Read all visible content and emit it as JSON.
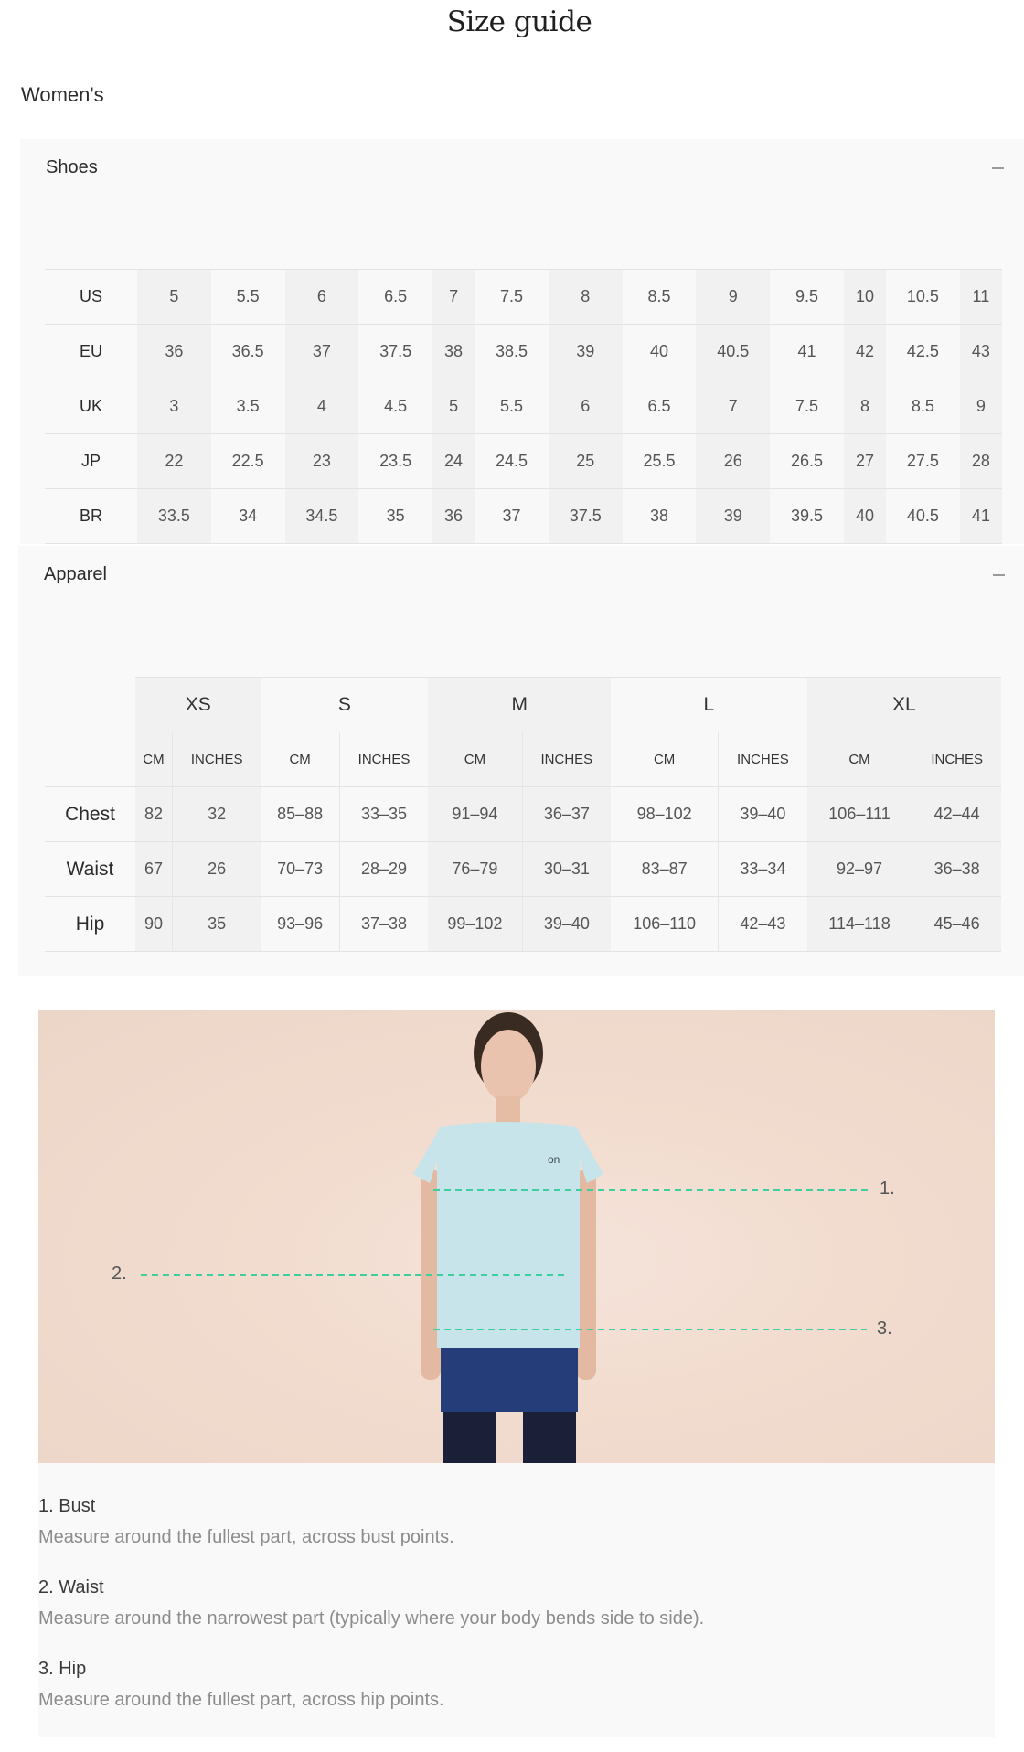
{
  "page": {
    "title": "Size guide",
    "section": "Women's"
  },
  "shoes": {
    "title": "Shoes",
    "collapse_icon": "minus-icon",
    "rows": [
      {
        "label": "US",
        "values": [
          "5",
          "5.5",
          "6",
          "6.5",
          "7",
          "7.5",
          "8",
          "8.5",
          "9",
          "9.5",
          "10",
          "10.5",
          "11"
        ]
      },
      {
        "label": "EU",
        "values": [
          "36",
          "36.5",
          "37",
          "37.5",
          "38",
          "38.5",
          "39",
          "40",
          "40.5",
          "41",
          "42",
          "42.5",
          "43"
        ]
      },
      {
        "label": "UK",
        "values": [
          "3",
          "3.5",
          "4",
          "4.5",
          "5",
          "5.5",
          "6",
          "6.5",
          "7",
          "7.5",
          "8",
          "8.5",
          "9"
        ]
      },
      {
        "label": "JP",
        "values": [
          "22",
          "22.5",
          "23",
          "23.5",
          "24",
          "24.5",
          "25",
          "25.5",
          "26",
          "26.5",
          "27",
          "27.5",
          "28"
        ]
      },
      {
        "label": "BR",
        "values": [
          "33.5",
          "34",
          "34.5",
          "35",
          "36",
          "37",
          "37.5",
          "38",
          "39",
          "39.5",
          "40",
          "40.5",
          "41"
        ]
      }
    ]
  },
  "apparel": {
    "title": "Apparel",
    "collapse_icon": "minus-icon",
    "sizes": [
      "XS",
      "S",
      "M",
      "L",
      "XL"
    ],
    "units": [
      "CM",
      "INCHES"
    ],
    "rows": [
      {
        "label": "Chest",
        "values": [
          "82",
          "32",
          "85–88",
          "33–35",
          "91–94",
          "36–37",
          "98–102",
          "39–40",
          "106–111",
          "42–44"
        ]
      },
      {
        "label": "Waist",
        "values": [
          "67",
          "26",
          "70–73",
          "28–29",
          "76–79",
          "30–31",
          "83–87",
          "33–34",
          "92–97",
          "36–38"
        ]
      },
      {
        "label": "Hip",
        "values": [
          "90",
          "35",
          "93–96",
          "37–38",
          "99–102",
          "39–40",
          "106–110",
          "42–43",
          "114–118",
          "45–46"
        ]
      }
    ]
  },
  "figure": {
    "markers": [
      "1.",
      "2.",
      "3."
    ],
    "line_color": "#3ecf9f"
  },
  "measurements": [
    {
      "title": "1. Bust",
      "text": "Measure around the fullest part, across bust points."
    },
    {
      "title": "2. Waist",
      "text": "Measure around the narrowest part (typically where your body bends side to side)."
    },
    {
      "title": "3. Hip",
      "text": "Measure around the fullest part, across hip points."
    }
  ]
}
